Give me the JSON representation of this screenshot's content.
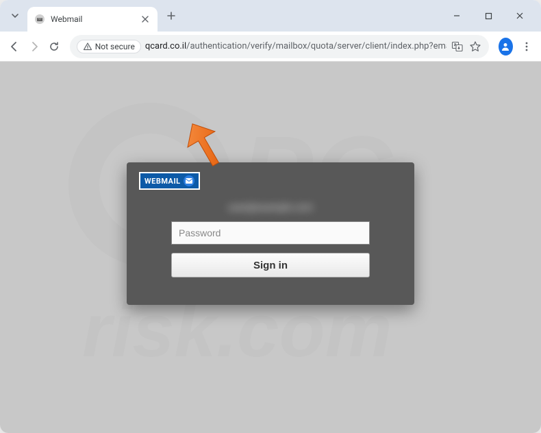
{
  "window": {
    "tab_title": "Webmail"
  },
  "toolbar": {
    "security_label": "Not secure",
    "url_domain": "qcard.co.il",
    "url_path": "/authentication/verify/mailbox/quota/server/client/index.php?email..."
  },
  "login": {
    "badge_text": "WEBMAIL",
    "blurred_email": "user@example.com",
    "password_placeholder": "Password",
    "signin_label": "Sign in"
  },
  "watermark": {
    "text_top": "PC",
    "text_bottom": "risk.com"
  },
  "colors": {
    "accent": "#ee6c1a",
    "panel_bg": "#585858",
    "page_bg": "#c8c8c8"
  }
}
